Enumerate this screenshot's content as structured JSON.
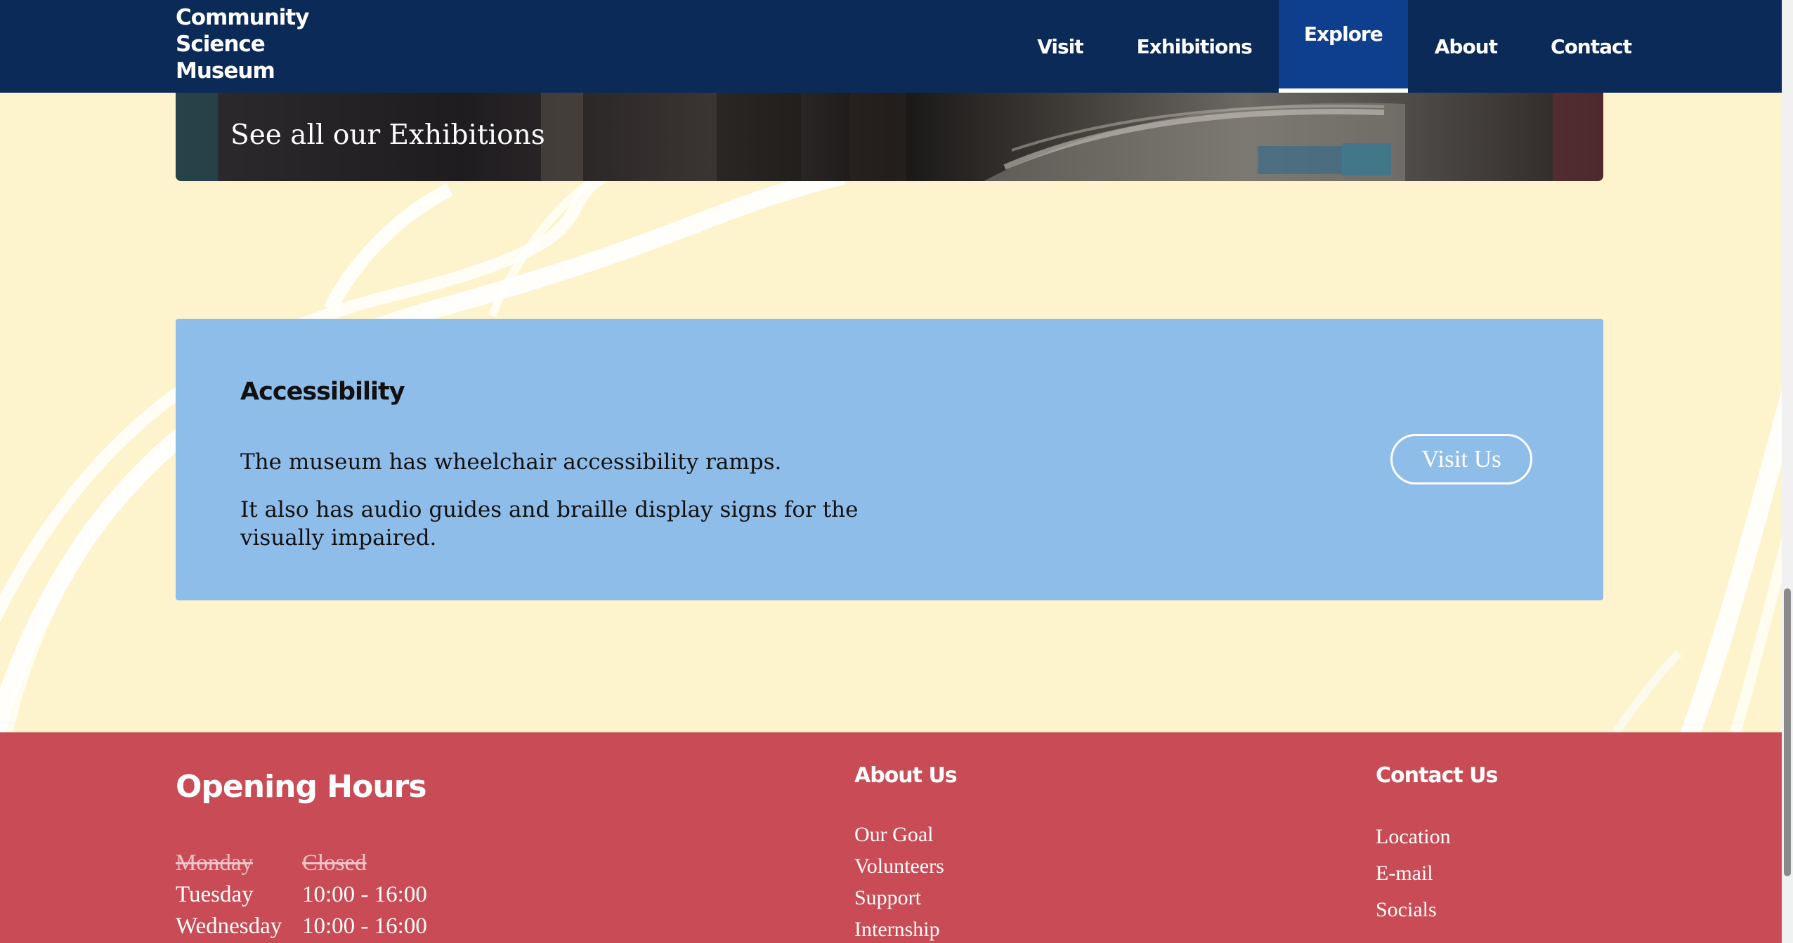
{
  "brand": {
    "line1": "Community",
    "line2": "Science",
    "line3": "Museum"
  },
  "nav": {
    "items": [
      {
        "label": "Visit"
      },
      {
        "label": "Exhibitions"
      },
      {
        "label": "Explore",
        "active": true
      },
      {
        "label": "About"
      },
      {
        "label": "Contact"
      }
    ]
  },
  "banner": {
    "label": "See all our Exhibitions"
  },
  "accessibility": {
    "title": "Accessibility",
    "paragraph1": "The museum has wheelchair accessibility ramps.",
    "paragraph2": "It also has audio guides and braille display signs for the visually impaired.",
    "button_label": "Visit Us"
  },
  "footer": {
    "hours_title": "Opening Hours",
    "hours": [
      {
        "day": "Monday",
        "time": "Closed",
        "closed": true
      },
      {
        "day": "Tuesday",
        "time": "10:00 - 16:00"
      },
      {
        "day": "Wednesday",
        "time": "10:00 - 16:00"
      }
    ],
    "about": {
      "heading": "About Us",
      "links": [
        "Our Goal",
        "Volunteers",
        "Support",
        "Internship"
      ]
    },
    "contact": {
      "heading": "Contact Us",
      "links": [
        "Location",
        "E-mail",
        "Socials"
      ]
    }
  },
  "colors": {
    "header_bg": "#0b2a58",
    "nav_active_bg": "#0e3f8f",
    "page_bg": "#fdf3cd",
    "card_bg": "#8fbdea",
    "footer_bg": "#c84b55"
  }
}
